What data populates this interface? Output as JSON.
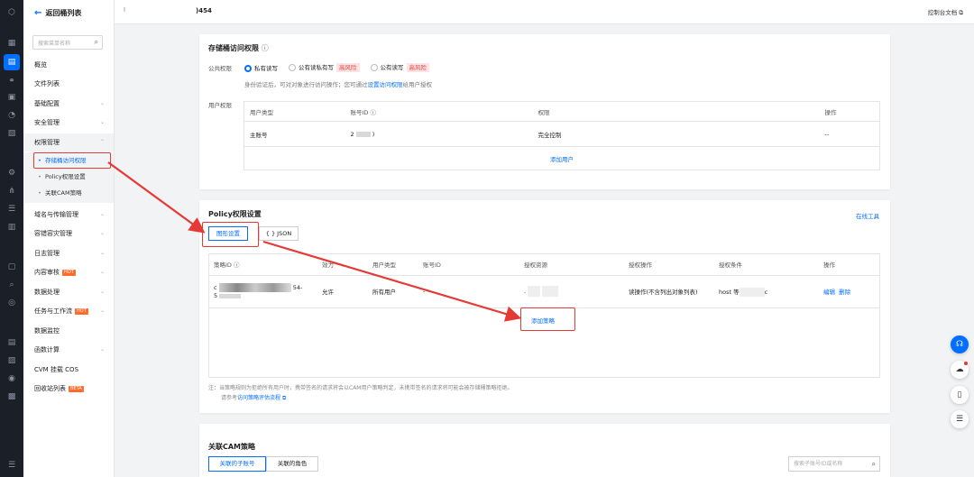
{
  "rail": {
    "icons": [
      "cloud-logo-icon",
      "grid-icon",
      "bucket-icon",
      "link-icon",
      "calendar-icon",
      "pie-icon",
      "doc-icon",
      "gear-icon",
      "tree-icon",
      "list-icon",
      "db-icon",
      "box-icon",
      "search-icon",
      "target-icon",
      "doc2-icon",
      "chart-icon",
      "circle-icon",
      "chip-icon",
      "collapse-icon"
    ]
  },
  "sidebar": {
    "back_label": "返回桶列表",
    "search_placeholder": "搜索菜单名称",
    "items": {
      "overview": "概览",
      "file_list": "文件列表",
      "basic_config": "基础配置",
      "security": "安全管理",
      "permission": "权限管理",
      "bucket_acl": "存储桶访问权限",
      "policy": "Policy权限设置",
      "cam": "关联CAM策略",
      "domain": "域名与传输管理",
      "disaster": "容错容灾管理",
      "logs": "日志管理",
      "audit": "内容审核",
      "data_process": "数据处理",
      "workflow": "任务与工作流",
      "monitor": "数据监控",
      "compute": "函数计算",
      "cvm": "CVM 挂载 COS",
      "recycle": "回收站列表"
    },
    "badges": {
      "hot": "HOT",
      "beta": "BETA"
    }
  },
  "topbar": {
    "tick": "I",
    "bucket_name": ")454",
    "doc_link": "控制台文档 ⧉"
  },
  "acl_card": {
    "title": "存储桶访问权限",
    "public_label": "公共权限",
    "options": [
      "私有读写",
      "公有读私有写",
      "公有读写"
    ],
    "risk_label": "高风险",
    "hint_prefix": "身份验证后，可对对象进行访问操作；您可通过",
    "hint_link": "设置访问权限",
    "hint_suffix": "给用户授权",
    "user_label": "用户权限",
    "headers": [
      "用户类型",
      "账号ID ⓘ",
      "权限",
      "操作"
    ],
    "row": {
      "type": "主账号",
      "id_left": "2",
      "id_right": ")",
      "perm": "完全控制",
      "op": "--"
    },
    "add_user": "添加用户"
  },
  "policy_card": {
    "title": "Policy权限设置",
    "online_tool": "在线工具",
    "tabs": [
      "图形设置",
      "{ } JSON"
    ],
    "headers": [
      "策略ID ⓘ",
      "效力",
      "用户类型",
      "账号ID",
      "授权资源",
      "授权操作",
      "授权条件",
      "操作"
    ],
    "row": {
      "id_a": "c",
      "id_b": "5",
      "id_suffix": "54-",
      "effect": "允许",
      "user_type": "所有用户",
      "account": "-",
      "resource": ".",
      "action": "读操作(不含列出对象列表)",
      "condition_prefix": "host 等",
      "condition_suffix": "c",
      "edit": "编辑",
      "delete": "删除"
    },
    "add_policy": "添加策略",
    "note_1": "注：当策略规则为拒绝所有用户时，携带签名的请求将会以CAM用户策略判定，未携带签名的请求将可能会被存储桶策略拒绝。",
    "note_2_prefix": "请参考",
    "note_2_link": "访问策略评估流程"
  },
  "cam_card": {
    "title": "关联CAM策略",
    "tabs": [
      "关联的子账号",
      "关联的角色"
    ],
    "search_placeholder": "搜索子账号ID或名称"
  },
  "floating": [
    "headset-icon",
    "cloud-notify-icon",
    "book-icon",
    "menu-list-icon"
  ],
  "colors": {
    "accent": "#006eff",
    "danger": "#e53935",
    "rail": "#1b1f27"
  }
}
